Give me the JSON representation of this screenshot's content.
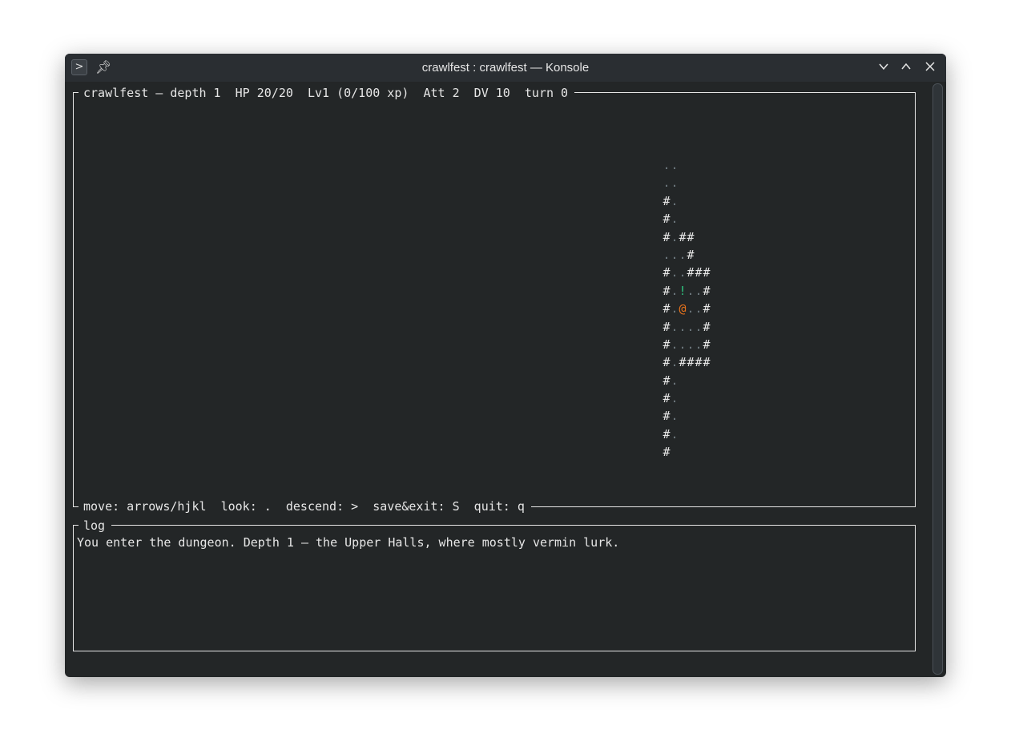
{
  "window": {
    "title": "crawlfest : crawlfest — Konsole",
    "app_icon": "terminal-prompt-icon",
    "pin_icon": "pin-icon",
    "buttons": {
      "minimize": "minimize-chevron-icon",
      "maximize": "maximize-chevron-icon",
      "close": "close-icon"
    }
  },
  "status": {
    "header": "crawlfest — depth 1  HP 20/20  Lv1 (0/100 xp)  Att 2  DV 10  turn 0",
    "footer": "move: arrows/hjkl  look: .  descend: >  save&exit: S  quit: q"
  },
  "log": {
    "title": "log",
    "lines": [
      "You enter the dungeon. Depth 1 — the Upper Halls, where mostly vermin lurk."
    ]
  },
  "map_rows": [
    " ..",
    " ..",
    " #.",
    " #.",
    " #.##",
    " ...#",
    " #..###",
    " #.!..#",
    " #.@..#",
    " #....#",
    " #....#",
    " #.####",
    " #.",
    " #.",
    " #.",
    " #.",
    " #"
  ],
  "colors": {
    "background": "#232627",
    "foreground": "#e6e6e6",
    "floor": "#6f7a80",
    "player": "#e8731c",
    "potion": "#2ec27e"
  }
}
